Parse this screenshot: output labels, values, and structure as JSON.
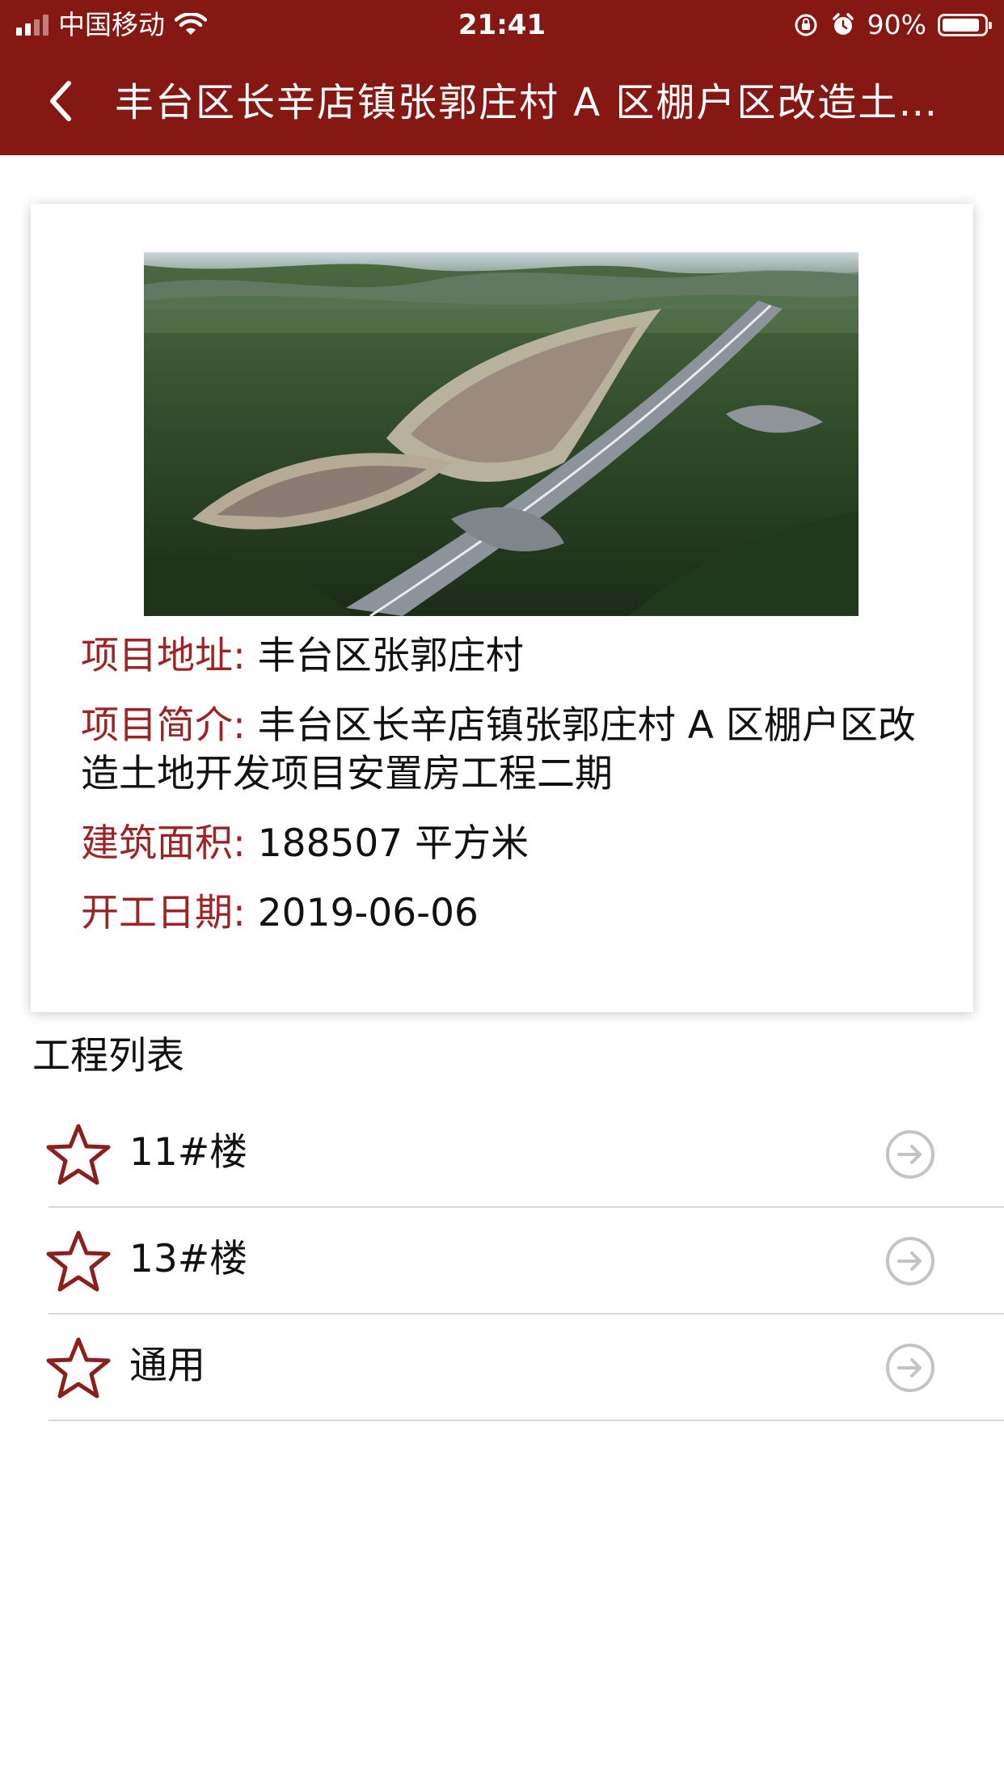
{
  "status_bar": {
    "carrier": "中国移动",
    "time": "21:41",
    "battery_percent": "90%",
    "battery_level": 0.9,
    "icons": [
      "signal-icon",
      "wifi-icon",
      "orientation-lock-icon",
      "alarm-icon",
      "battery-icon"
    ]
  },
  "nav": {
    "back_icon": "chevron-left-icon",
    "title": "丰台区长辛店镇张郭庄村 A 区棚户区改造土地开发项目安置房工程二期"
  },
  "project": {
    "image_alt": "aerial-rendering-of-residential-development",
    "address_label": "项目地址:",
    "address_value": " 丰台区张郭庄村",
    "intro_label": "项目简介:",
    "intro_value": " 丰台区长辛店镇张郭庄村 A 区棚户区改造土地开发项目安置房工程二期",
    "area_label": "建筑面积:",
    "area_value": " 188507 平方米",
    "start_label": "开工日期:",
    "start_value": " 2019-06-06"
  },
  "list_section": {
    "title": "工程列表",
    "items": [
      {
        "label": "11#楼",
        "icon": "star-icon",
        "action_icon": "arrow-right-circle-icon"
      },
      {
        "label": "13#楼",
        "icon": "star-icon",
        "action_icon": "arrow-right-circle-icon"
      },
      {
        "label": "通用",
        "icon": "star-icon",
        "action_icon": "arrow-right-circle-icon"
      }
    ]
  },
  "colors": {
    "header_bg": "#861813",
    "label": "#9c2425",
    "star": "#8a1f1c",
    "arrow": "#c4c4c4"
  }
}
